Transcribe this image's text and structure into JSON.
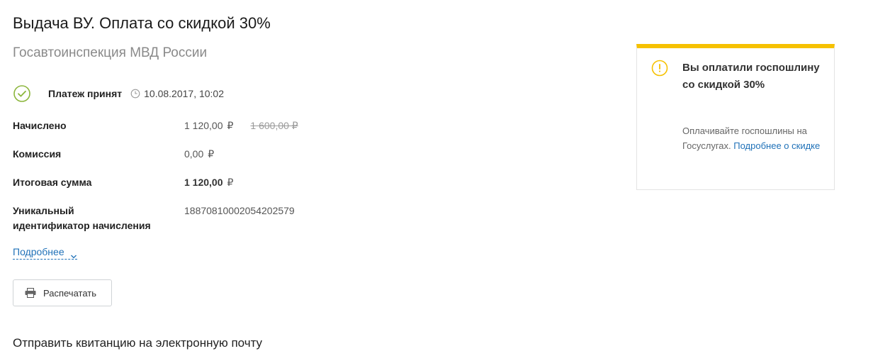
{
  "header": {
    "title": "Выдача ВУ. Оплата со скидкой 30%",
    "subtitle": "Госавтоинспекция МВД России"
  },
  "status": {
    "label": "Платеж принят",
    "datetime": "10.08.2017, 10:02",
    "color": "#8cb63c"
  },
  "details": {
    "accrued_label": "Начислено",
    "accrued_value": "1 120,00",
    "accrued_old_value": "1 600,00 ₽",
    "commission_label": "Комиссия",
    "commission_value": "0,00",
    "total_label": "Итоговая сумма",
    "total_value": "1 120,00",
    "uid_label_line1": "Уникальный",
    "uid_label_line2": "идентификатор начисления",
    "uid_value": "18870810002054202579",
    "currency": "₽"
  },
  "more_link": "Подробнее",
  "print_button": "Распечатать",
  "email_section_title": "Отправить квитанцию на электронную почту",
  "info_panel": {
    "title": "Вы оплатили госпошлину со скидкой 30%",
    "text": "Оплачивайте госпошлины на Госуслугах.",
    "link": "Подробнее о скидке",
    "accent_color": "#f6c100",
    "link_color": "#1f71b8"
  },
  "icons": {
    "status": "check-circle-icon",
    "time": "clock-icon",
    "more": "chevron-down-icon",
    "print": "printer-icon",
    "info": "exclamation-circle-icon"
  }
}
